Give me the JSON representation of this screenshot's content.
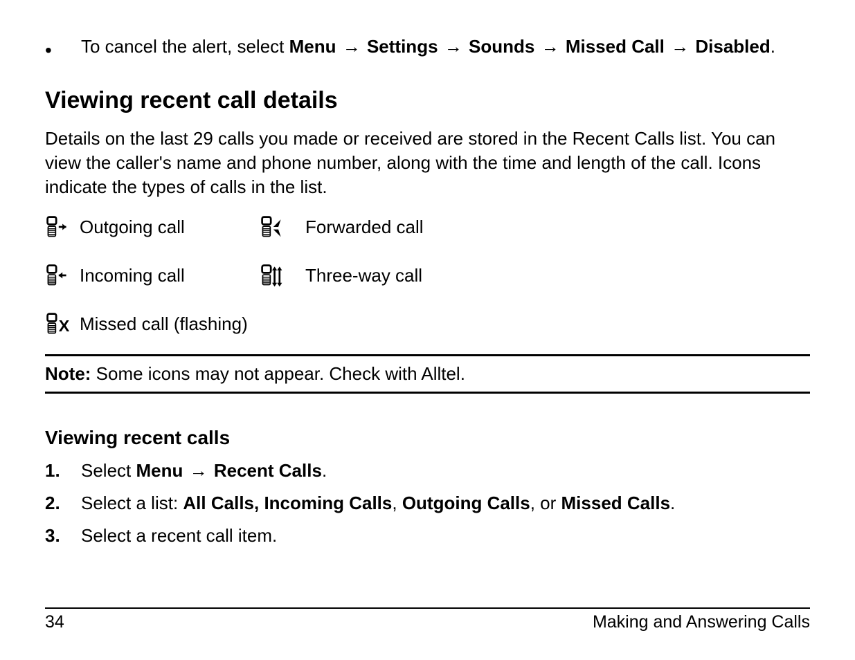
{
  "top_bullet": {
    "lead": "To cancel the alert, select ",
    "path": [
      "Menu",
      "Settings",
      "Sounds",
      "Missed Call",
      "Disabled"
    ],
    "trail": "."
  },
  "section_heading": "Viewing recent call details",
  "body_paragraph": "Details on the last 29 calls you made or received are stored in the Recent Calls list. You can view the caller's name and phone number, along with the time and length of the call. Icons indicate the types of calls in the list.",
  "legend": {
    "row1a": "Outgoing call",
    "row1b": "Forwarded call",
    "row2a": "Incoming call",
    "row2b": "Three-way call",
    "row3a": "Missed call (flashing)"
  },
  "note": {
    "label": "Note:",
    "text": " Some icons may not appear. Check with Alltel."
  },
  "subsection_heading": "Viewing recent calls",
  "steps": [
    {
      "n": "1.",
      "lead": "Select ",
      "bold": "Menu",
      "arrow_then": "Recent Calls",
      "trail": "."
    },
    {
      "n": "2.",
      "lead": "Select a list: ",
      "bold_list": "All Calls, Incoming Calls",
      "sep1": ", ",
      "bold2": "Outgoing Calls",
      "sep2": ", or ",
      "bold3": "Missed Calls",
      "trail": "."
    },
    {
      "n": "3.",
      "lead": "Select a recent call item.",
      "bold": "",
      "trail": ""
    }
  ],
  "footer": {
    "page": "34",
    "chapter": "Making and Answering Calls"
  },
  "arrow_glyph": "→"
}
